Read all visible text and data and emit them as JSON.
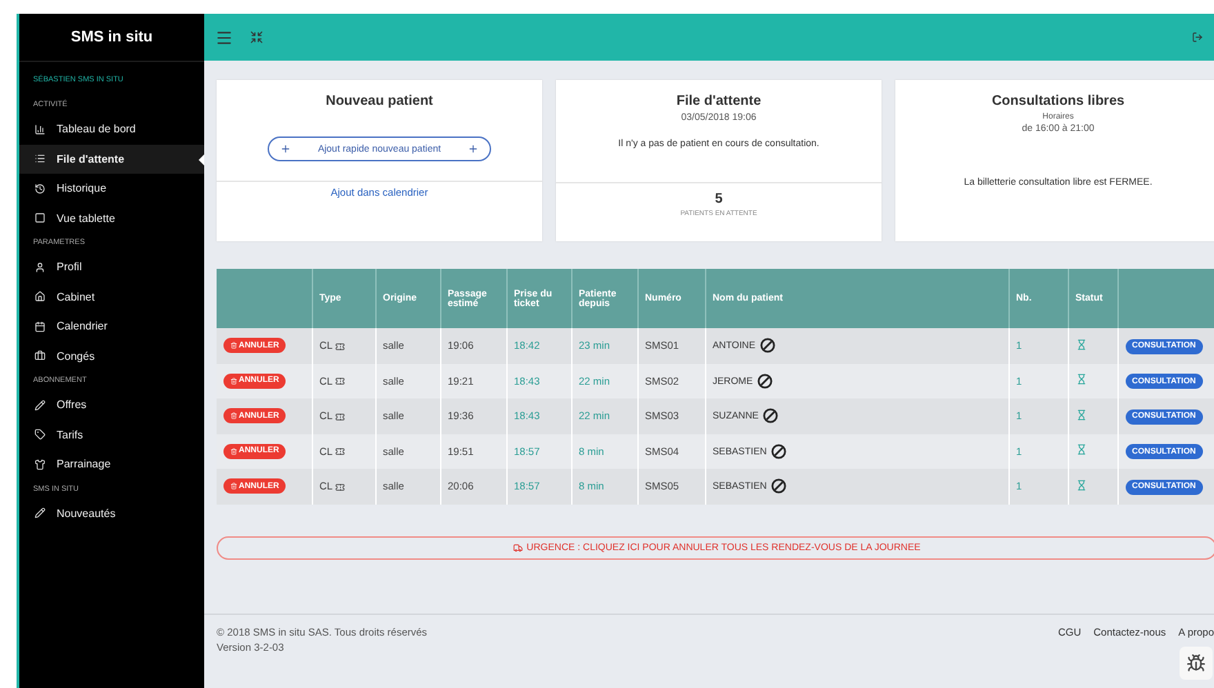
{
  "sidebar": {
    "brand": "SMS in situ",
    "user": "SÉBASTIEN SMS IN SITU",
    "sections": [
      {
        "title": "ACTIVITÉ",
        "items": [
          {
            "label": "Tableau de bord",
            "selected": false
          },
          {
            "label": "File d'attente",
            "selected": true
          },
          {
            "label": "Historique",
            "selected": false
          },
          {
            "label": "Vue tablette",
            "selected": false
          }
        ]
      },
      {
        "title": "PARAMETRES",
        "items": [
          {
            "label": "Profil",
            "selected": false
          },
          {
            "label": "Cabinet",
            "selected": false
          },
          {
            "label": "Calendrier",
            "selected": false
          },
          {
            "label": "Congés",
            "selected": false
          }
        ]
      },
      {
        "title": "ABONNEMENT",
        "items": [
          {
            "label": "Offres",
            "selected": false
          },
          {
            "label": "Tarifs",
            "selected": false
          },
          {
            "label": "Parrainage",
            "selected": false
          }
        ]
      },
      {
        "title": "SMS IN SITU",
        "items": [
          {
            "label": "Nouveautés",
            "selected": false
          }
        ]
      }
    ]
  },
  "cards": [
    {
      "title": "Nouveau patient",
      "button": "Ajout rapide nouveau patient",
      "link": "Ajout dans calendrier"
    },
    {
      "title": "File d'attente",
      "date": "03/05/2018 19:06",
      "message": "Il n'y a pas de patient en cours de consultation.",
      "count": "5",
      "count_label": "PATIENTS EN ATTENTE"
    },
    {
      "title": "Consultations libres",
      "subtitle": "Horaires",
      "hours": "de 16:00 à 21:00",
      "message": "La billetterie consultation libre est FERMEE."
    }
  ],
  "table": {
    "columns": [
      "Type",
      "Origine",
      "Passage estimé",
      "Prise du ticket",
      "Patiente depuis",
      "Numéro",
      "Nom du patient",
      "Nb.",
      "Statut"
    ],
    "rows": [
      {
        "cancel": "ANNULER",
        "type": "CL",
        "origin": "salle",
        "passage": "19:06",
        "ticket": "18:42",
        "waiting": "23 min",
        "number": "SMS01",
        "name": "ANTOINE",
        "nb": "1",
        "action": "CONSULTATION"
      },
      {
        "cancel": "ANNULER",
        "type": "CL",
        "origin": "salle",
        "passage": "19:21",
        "ticket": "18:43",
        "waiting": "22 min",
        "number": "SMS02",
        "name": "JEROME",
        "nb": "1",
        "action": "CONSULTATION"
      },
      {
        "cancel": "ANNULER",
        "type": "CL",
        "origin": "salle",
        "passage": "19:36",
        "ticket": "18:43",
        "waiting": "22 min",
        "number": "SMS03",
        "name": "SUZANNE",
        "nb": "1",
        "action": "CONSULTATION"
      },
      {
        "cancel": "ANNULER",
        "type": "CL",
        "origin": "salle",
        "passage": "19:51",
        "ticket": "18:57",
        "waiting": "8 min",
        "number": "SMS04",
        "name": "SEBASTIEN",
        "nb": "1",
        "action": "CONSULTATION"
      },
      {
        "cancel": "ANNULER",
        "type": "CL",
        "origin": "salle",
        "passage": "20:06",
        "ticket": "18:57",
        "waiting": "8 min",
        "number": "SMS05",
        "name": "SEBASTIEN",
        "nb": "1",
        "action": "CONSULTATION"
      }
    ]
  },
  "urgence": "URGENCE : CLIQUEZ ICI POUR ANNULER TOUS LES RENDEZ-VOUS DE LA JOURNEE",
  "footer": {
    "copyright": "© 2018 SMS in situ SAS. Tous droits réservés",
    "version": "Version 3-2-03",
    "links": [
      "CGU",
      "Contactez-nous",
      "A propo"
    ]
  }
}
